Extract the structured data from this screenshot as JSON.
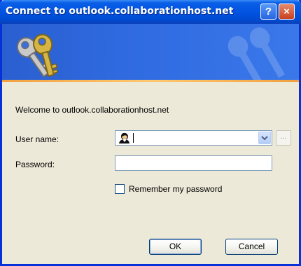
{
  "window": {
    "title": "Connect to outlook.collaborationhost.net",
    "help_label": "?",
    "close_label": "×"
  },
  "form": {
    "welcome_text": "Welcome to outlook.collaborationhost.net",
    "username_label": "User name:",
    "username_value": "",
    "password_label": "Password:",
    "password_value": "",
    "browse_label": "...",
    "remember_label": "Remember my password",
    "remember_checked": false
  },
  "buttons": {
    "ok_label": "OK",
    "cancel_label": "Cancel"
  },
  "colors": {
    "titlebar": "#0052e0",
    "banner": "#2f6ae0",
    "dialog_bg": "#ece9d8",
    "accent_line": "#f0a040"
  }
}
